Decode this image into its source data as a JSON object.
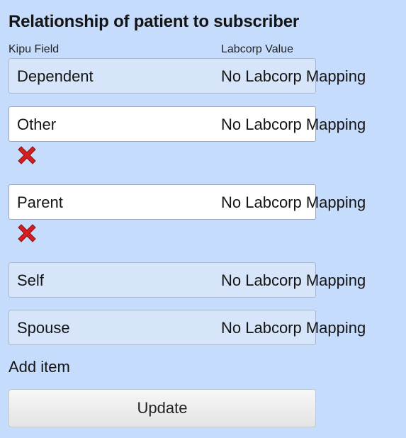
{
  "form": {
    "title": "Relationship of patient to subscriber",
    "column_headers": {
      "kipu": "Kipu Field",
      "labcorp": "Labcorp Value"
    },
    "rows": [
      {
        "kipu_field": "Dependent",
        "labcorp_value": "No Labcorp Mapping",
        "editable": false
      },
      {
        "kipu_field": "Other",
        "labcorp_value": "No Labcorp Mapping",
        "editable": true
      },
      {
        "kipu_field": "Parent",
        "labcorp_value": "No Labcorp Mapping",
        "editable": true
      },
      {
        "kipu_field": "Self",
        "labcorp_value": "No Labcorp Mapping",
        "editable": false
      },
      {
        "kipu_field": "Spouse",
        "labcorp_value": "No Labcorp Mapping",
        "editable": false
      }
    ],
    "add_item_label": "Add item",
    "update_label": "Update"
  },
  "icons": {
    "delete": "close-x-icon"
  },
  "colors": {
    "background": "#c6dcfc",
    "disabled_row": "#d6e5f9",
    "editable_row": "#ffffff",
    "delete_red": "#d31f1f"
  }
}
